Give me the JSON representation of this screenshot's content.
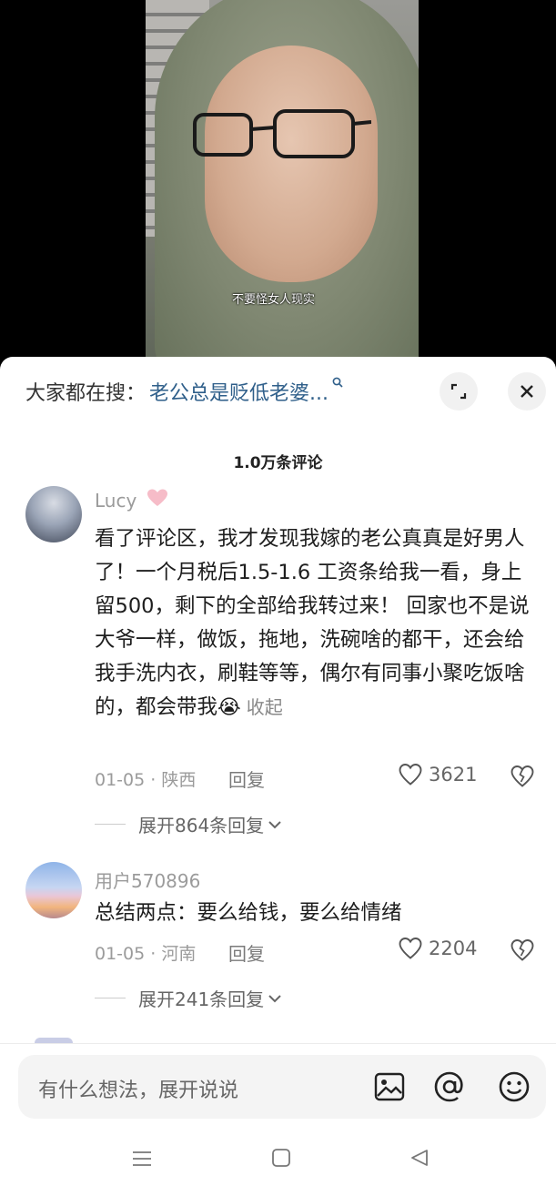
{
  "video": {
    "subtitle": "不要怪女人现实"
  },
  "search": {
    "prefix": "大家都在搜：",
    "term": "老公总是贬低老婆..."
  },
  "comments_header": {
    "count_label": "1.0万条评论"
  },
  "comments": [
    {
      "username": "Lucy",
      "text": "看了评论区，我才发现我嫁的老公真真是好男人了！一个月税后1.5-1.6  工资条给我一看，身上留500，剩下的全部给我转过来！ 回家也不是说大爷一样，做饭，拖地，洗碗啥的都干，还会给我手洗内衣，刷鞋等等，偶尔有同事小聚吃饭啥的，都会带我",
      "emoji": "😭",
      "collapse": "收起",
      "meta": "01-05 · 陕西",
      "reply": "回复",
      "likes": "3621",
      "expand_replies": "展开864条回复"
    },
    {
      "username": "用户570896",
      "text": "总结两点：要么给钱，要么给情绪",
      "meta": "01-05 · 河南",
      "reply": "回复",
      "likes": "2204",
      "expand_replies": "展开241条回复"
    }
  ],
  "input": {
    "placeholder": "有什么想法，展开说说"
  },
  "icons": {
    "search_hint": "search-icon",
    "expand": "expand-icon",
    "close": "close-icon",
    "heart": "heart-icon",
    "dislike": "broken-heart-icon",
    "image": "image-icon",
    "at": "at-icon",
    "emoji": "emoji-icon"
  }
}
